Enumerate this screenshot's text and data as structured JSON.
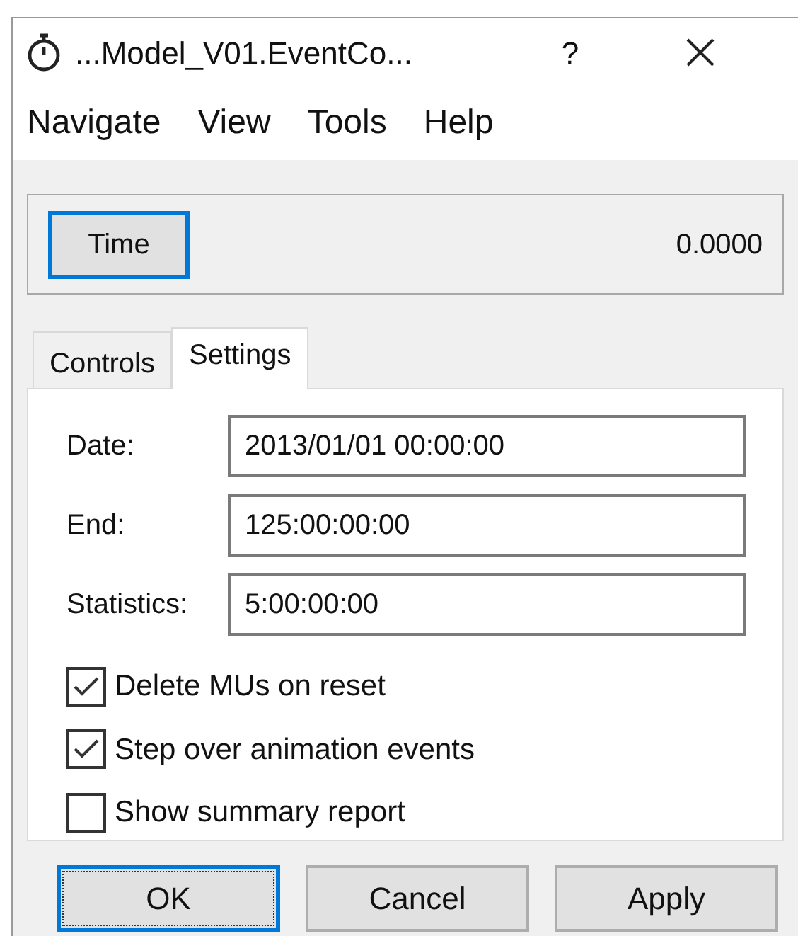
{
  "window": {
    "title": "...Model_V01.EventCo...",
    "help": "?"
  },
  "menu": [
    "Navigate",
    "View",
    "Tools",
    "Help"
  ],
  "time_panel": {
    "button": "Time",
    "focused": true,
    "value": "0.0000"
  },
  "tabs": [
    {
      "label": "Controls",
      "selected": false
    },
    {
      "label": "Settings",
      "selected": true
    }
  ],
  "fields": [
    {
      "label": "Date:",
      "value": "2013/01/01 00:00:00"
    },
    {
      "label": "End:",
      "value": "125:00:00:00"
    },
    {
      "label": "Statistics:",
      "value": "5:00:00:00"
    }
  ],
  "checkboxes": [
    {
      "label": "Delete MUs on reset",
      "checked": true
    },
    {
      "label": "Step over animation events",
      "checked": true
    },
    {
      "label": "Show summary report",
      "checked": false
    }
  ],
  "buttons": [
    {
      "label": "OK",
      "default": true
    },
    {
      "label": "Cancel",
      "default": false
    },
    {
      "label": "Apply",
      "default": false
    }
  ]
}
